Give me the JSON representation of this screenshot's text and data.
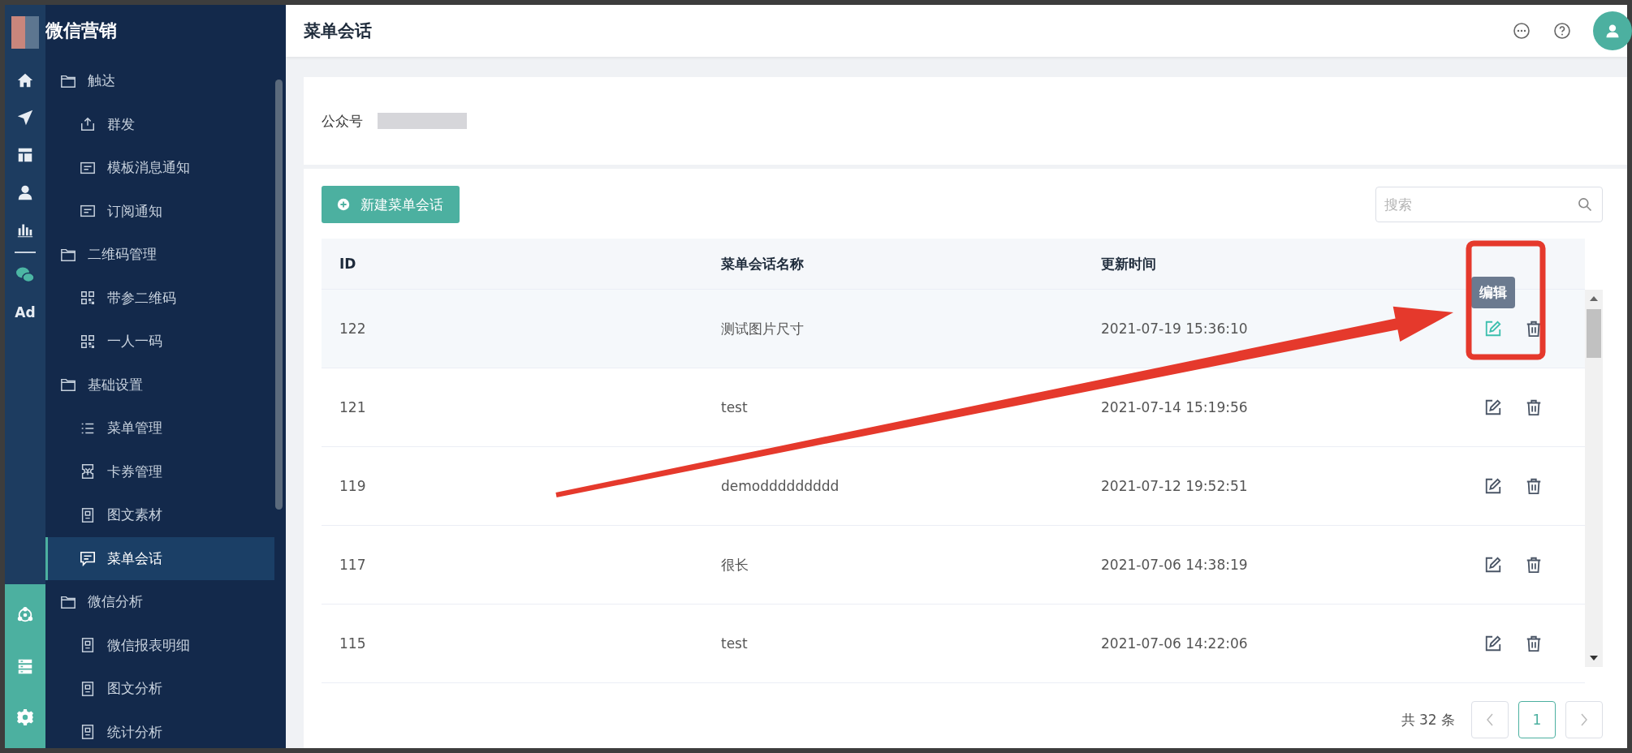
{
  "app": {
    "title": "微信营销",
    "rail_label": "Ad"
  },
  "sidebar": {
    "items": [
      {
        "label": "触达",
        "children": [
          {
            "label": "群发",
            "kind": "upload",
            "selected": false
          },
          {
            "label": "模板消息通知",
            "kind": "card",
            "selected": false
          },
          {
            "label": "订阅通知",
            "kind": "card",
            "selected": false
          }
        ]
      },
      {
        "label": "二维码管理",
        "children": [
          {
            "label": "带参二维码",
            "kind": "qr",
            "selected": false
          },
          {
            "label": "一人一码",
            "kind": "qr",
            "selected": false
          }
        ]
      },
      {
        "label": "基础设置",
        "children": [
          {
            "label": "菜单管理",
            "kind": "list",
            "selected": false
          },
          {
            "label": "卡券管理",
            "kind": "coupon",
            "selected": false
          },
          {
            "label": "图文素材",
            "kind": "doc",
            "selected": false
          },
          {
            "label": "菜单会话",
            "kind": "chat",
            "selected": true
          }
        ]
      },
      {
        "label": "微信分析",
        "children": [
          {
            "label": "微信报表明细",
            "kind": "doc",
            "selected": false
          },
          {
            "label": "图文分析",
            "kind": "doc",
            "selected": false
          },
          {
            "label": "统计分析",
            "kind": "doc",
            "selected": false
          }
        ]
      }
    ]
  },
  "header": {
    "title": "菜单会话"
  },
  "account": {
    "label": "公众号"
  },
  "toolbar": {
    "new_button": "新建菜单会话",
    "search": {
      "placeholder": "搜索"
    }
  },
  "table": {
    "columns": [
      "ID",
      "菜单会话名称",
      "更新时间"
    ],
    "rows": [
      {
        "id": "122",
        "name": "测试图片尺寸",
        "updated": "2021-07-19 15:36:10",
        "selected": true,
        "tooltip": "编辑"
      },
      {
        "id": "121",
        "name": "test",
        "updated": "2021-07-14 15:19:56",
        "selected": false
      },
      {
        "id": "119",
        "name": "demoddddddddd",
        "updated": "2021-07-12 19:52:51",
        "selected": false
      },
      {
        "id": "117",
        "name": "很长",
        "updated": "2021-07-06 14:38:19",
        "selected": false
      },
      {
        "id": "115",
        "name": "test",
        "updated": "2021-07-06 14:22:06",
        "selected": false
      }
    ]
  },
  "pagination": {
    "total": "共 32 条",
    "pages": [
      {
        "label": "1",
        "selected": true
      }
    ]
  }
}
